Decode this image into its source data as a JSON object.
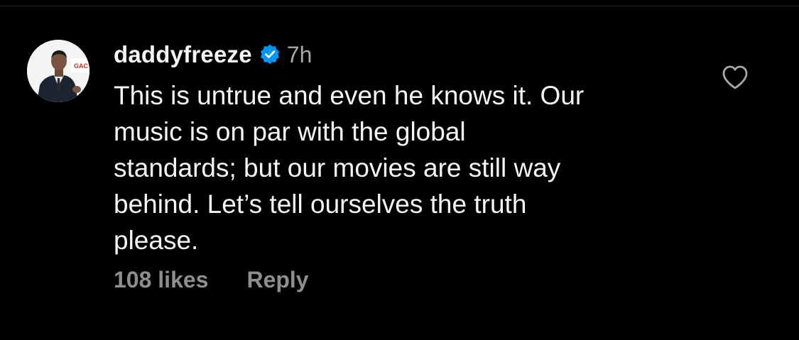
{
  "comment": {
    "username": "daddyfreeze",
    "verified": true,
    "timestamp": "7h",
    "avatar_icon": "profile-photo-icon",
    "text_lines": [
      "This is untrue and even he knows it. Our",
      "music is on par with the global",
      "standards; but our movies are still way",
      "behind. Let’s tell ourselves the truth",
      "please."
    ],
    "likes_label": "108 likes",
    "reply_label": "Reply",
    "like_icon": "heart-outline-icon",
    "verified_icon": "verified-badge-icon"
  },
  "colors": {
    "background": "#000000",
    "primary_text": "#f5f5f5",
    "secondary_text": "#a8a8a8",
    "footer_text": "#8e8e8e",
    "verified_blue": "#0095f6"
  }
}
